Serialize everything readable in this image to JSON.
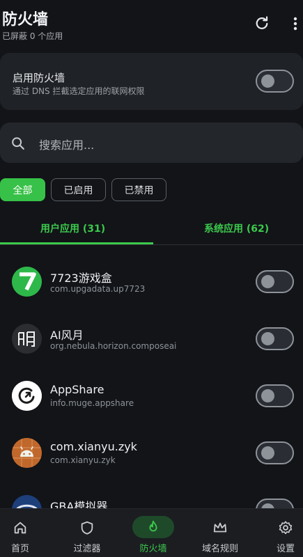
{
  "header": {
    "title": "防火墙",
    "subtitle": "已屏蔽 0 个应用"
  },
  "firewall": {
    "label": "启用防火墙",
    "desc": "通过 DNS 拦截选定应用的联网权限",
    "enabled": false
  },
  "search": {
    "placeholder": "搜索应用..."
  },
  "filters": [
    {
      "label": "全部",
      "active": true
    },
    {
      "label": "已启用",
      "active": false
    },
    {
      "label": "已禁用",
      "active": false
    }
  ],
  "tabs": [
    {
      "label": "用户应用 (31)",
      "active": true
    },
    {
      "label": "系统应用 (62)",
      "active": false
    }
  ],
  "apps": [
    {
      "name": "7723游戏盒",
      "pkg": "com.upgadata.up7723",
      "icon": "7723-logo-icon",
      "enabled": false
    },
    {
      "name": "AI风月",
      "pkg": "org.nebula.horizon.composeai",
      "icon": "ai-fengyue-logo-icon",
      "enabled": false
    },
    {
      "name": "AppShare",
      "pkg": "info.muge.appshare",
      "icon": "appshare-logo-icon",
      "enabled": false
    },
    {
      "name": "com.xianyu.zyk",
      "pkg": "com.xianyu.zyk",
      "icon": "android-robot-icon",
      "enabled": false
    },
    {
      "name": "GBA模拟器",
      "pkg": "",
      "icon": "gba-logo-icon",
      "enabled": false
    }
  ],
  "nav": [
    {
      "label": "首页",
      "icon": "home-icon",
      "active": false
    },
    {
      "label": "过滤器",
      "icon": "shield-icon",
      "active": false
    },
    {
      "label": "防火墙",
      "icon": "flame-icon",
      "active": true
    },
    {
      "label": "域名规则",
      "icon": "crown-icon",
      "active": false
    },
    {
      "label": "设置",
      "icon": "gear-icon",
      "active": false
    }
  ],
  "colors": {
    "accent": "#3cc94c",
    "background": "#121418",
    "card": "#1f2227"
  }
}
